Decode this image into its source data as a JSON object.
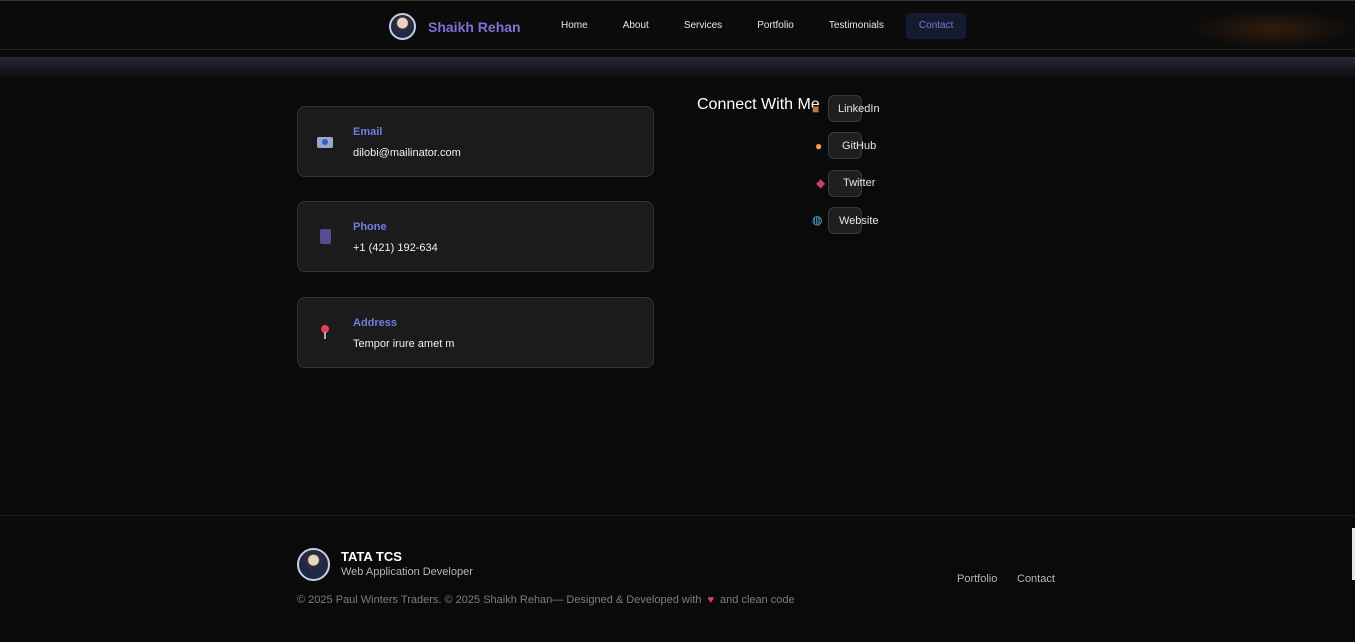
{
  "header": {
    "brand_name": "Shaikh Rehan",
    "nav": [
      "Home",
      "About",
      "Services",
      "Portfolio",
      "Testimonials",
      "Contact"
    ],
    "active_nav": "Contact"
  },
  "contact_cards": [
    {
      "icon": "email-icon",
      "label": "Email",
      "value": "dilobi@mailinator.com"
    },
    {
      "icon": "phone-icon",
      "label": "Phone",
      "value": "+1 (421) 192-634"
    },
    {
      "icon": "pin-icon",
      "label": "Address",
      "value": "Tempor irure amet m"
    }
  ],
  "connect": {
    "title": "Connect With Me",
    "links": [
      {
        "icon": "briefcase-icon",
        "label": "LinkedIn"
      },
      {
        "icon": "octopus-icon",
        "label": "GitHub"
      },
      {
        "icon": "bird-icon",
        "label": "Twitter"
      },
      {
        "icon": "globe-icon",
        "label": "Website"
      }
    ]
  },
  "footer": {
    "name": "TATA TCS",
    "role": "Web Application Developer",
    "links": [
      "Portfolio",
      "Contact"
    ],
    "copyright_prefix": "© 2025 Paul Winters Traders. © 2025 Shaikh Rehan— Designed & Developed with",
    "copyright_suffix": "and clean code"
  },
  "colors": {
    "accent": "#6f7fe0",
    "brand": "#7b72d6",
    "heart": "#e03e6a"
  }
}
